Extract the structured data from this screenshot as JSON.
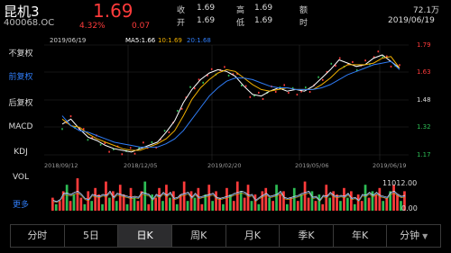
{
  "stock": {
    "name": "昆机3",
    "code": "400068.OC",
    "price": "1.69",
    "change_pct": "4.32%",
    "change": "0.07"
  },
  "stats": {
    "open_label": "收",
    "open": "1.69",
    "high_label": "高",
    "high": "1.69",
    "amount_label": "额",
    "amount": "72.1万",
    "open2_label": "开",
    "open2": "1.69",
    "low_label": "低",
    "low": "1.69",
    "time_label": "时",
    "time": "2019/06/19"
  },
  "sidebar": {
    "items": [
      "不复权",
      "前复权",
      "后复权",
      "MACD",
      "KDJ",
      "VOL",
      "更多"
    ],
    "active": "前复权"
  },
  "chart_header": {
    "date": "2019/06/19",
    "ma5_label": "MA5:",
    "ma5": "1.66",
    "ma10_label": "10:",
    "ma10": "1.69",
    "ma20_label": "20:",
    "ma20": "1.68"
  },
  "y_axis": [
    "1.79",
    "1.63",
    "1.48",
    "1.32",
    "1.17"
  ],
  "x_axis": [
    "2018/09/12",
    "2018/12/05",
    "2019/02/20",
    "2019/05/06",
    "2019/06/19"
  ],
  "volume": {
    "max_label": "11012.00",
    "min_label": "0.00"
  },
  "colors": {
    "up": "#ff3b3b",
    "down": "#2dbd55",
    "ma5": "#ffffff",
    "ma10": "#f0b000",
    "ma20": "#2f7cf6",
    "active": "#2f7cf6"
  },
  "tabs": [
    {
      "label": "分时"
    },
    {
      "label": "5日"
    },
    {
      "label": "日K",
      "selected": true
    },
    {
      "label": "周K"
    },
    {
      "label": "月K"
    },
    {
      "label": "季K"
    },
    {
      "label": "年K"
    },
    {
      "label": "分钟",
      "dropdown": true
    }
  ],
  "chart_data": {
    "type": "line",
    "ylim": [
      1.13,
      1.83
    ],
    "series": [
      {
        "name": "MA5",
        "values": [
          1.35,
          1.38,
          1.32,
          1.27,
          1.25,
          1.22,
          1.2,
          1.19,
          1.18,
          1.2,
          1.22,
          1.24,
          1.3,
          1.37,
          1.48,
          1.56,
          1.62,
          1.66,
          1.68,
          1.67,
          1.64,
          1.58,
          1.53,
          1.52,
          1.55,
          1.57,
          1.55,
          1.56,
          1.55,
          1.58,
          1.63,
          1.68,
          1.74,
          1.72,
          1.7,
          1.71,
          1.75,
          1.77,
          1.73,
          1.69
        ]
      },
      {
        "name": "10",
        "values": [
          1.38,
          1.34,
          1.33,
          1.29,
          1.26,
          1.24,
          1.22,
          1.2,
          1.19,
          1.19,
          1.21,
          1.23,
          1.26,
          1.31,
          1.4,
          1.5,
          1.57,
          1.62,
          1.66,
          1.68,
          1.67,
          1.63,
          1.59,
          1.56,
          1.55,
          1.56,
          1.57,
          1.56,
          1.56,
          1.56,
          1.59,
          1.63,
          1.68,
          1.71,
          1.71,
          1.71,
          1.72,
          1.75,
          1.76,
          1.69
        ]
      },
      {
        "name": "20",
        "values": [
          1.4,
          1.34,
          1.31,
          1.3,
          1.28,
          1.26,
          1.24,
          1.23,
          1.22,
          1.21,
          1.21,
          1.21,
          1.23,
          1.26,
          1.31,
          1.38,
          1.45,
          1.52,
          1.57,
          1.61,
          1.63,
          1.63,
          1.62,
          1.6,
          1.58,
          1.57,
          1.57,
          1.56,
          1.56,
          1.56,
          1.57,
          1.59,
          1.62,
          1.65,
          1.67,
          1.69,
          1.71,
          1.72,
          1.73,
          1.68
        ]
      }
    ],
    "volume": [
      4,
      2,
      3,
      6,
      8,
      3,
      5,
      10,
      4,
      2,
      6,
      3,
      7,
      5,
      2,
      9,
      4,
      6,
      3,
      8,
      5,
      2,
      7,
      4,
      3,
      6,
      9,
      2,
      5,
      4,
      7,
      3,
      8,
      4,
      6,
      2,
      5,
      9,
      3,
      6,
      4,
      7,
      2,
      5,
      8,
      3,
      6,
      4,
      2,
      7,
      5,
      3,
      9,
      6,
      4,
      8,
      3,
      5,
      2,
      6,
      7,
      4,
      3,
      8,
      5,
      6,
      2,
      4,
      7,
      3,
      5,
      9,
      4,
      6,
      3,
      5,
      2,
      8,
      4,
      6,
      5,
      3,
      7,
      4,
      6,
      2,
      5,
      3,
      8,
      4,
      6,
      5,
      7,
      3,
      4,
      6,
      8,
      5,
      3,
      6
    ],
    "volume_up": [
      1,
      0,
      1,
      1,
      0,
      1,
      0,
      1,
      1,
      0,
      1,
      0,
      1,
      1,
      0,
      1,
      0,
      1,
      0,
      1,
      1,
      0,
      1,
      0,
      1,
      1,
      0,
      1,
      0,
      1,
      1,
      0,
      1,
      0,
      1,
      0,
      1,
      1,
      0,
      1,
      0,
      1,
      1,
      0,
      1,
      0,
      1,
      1,
      0,
      1,
      0,
      1,
      1,
      0,
      1,
      1,
      0,
      1,
      0,
      1,
      1,
      0,
      1,
      0,
      1,
      1,
      0,
      1,
      0,
      1,
      0,
      1,
      1,
      0,
      1,
      0,
      1,
      1,
      0,
      1,
      1,
      0,
      1,
      0,
      1,
      0,
      1,
      1,
      0,
      1,
      0,
      1,
      1,
      0,
      1,
      0,
      1,
      1,
      0,
      1
    ]
  }
}
